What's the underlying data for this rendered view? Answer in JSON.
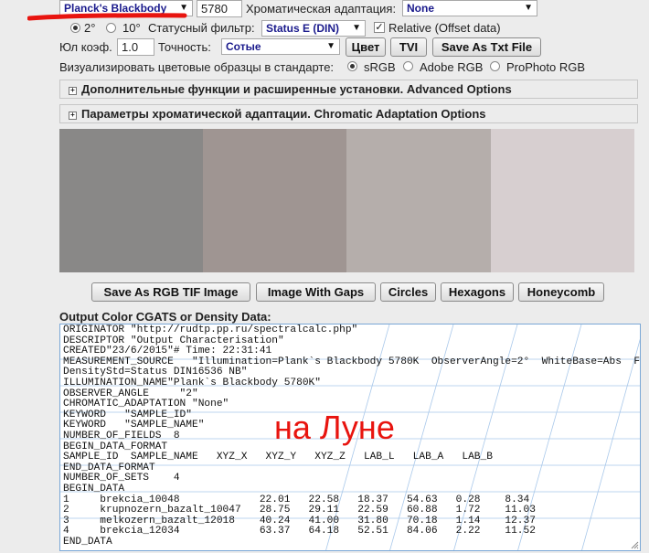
{
  "top_row": {
    "source_select": "Planck's Blackbody",
    "temperature_value": "5780",
    "adaptation_label": "Хроматическая адаптация:",
    "adaptation_select": "None"
  },
  "row2": {
    "observer_2": "2°",
    "observer_10": "10°",
    "status_filter_label": "Статусный фильтр:",
    "status_filter_select": "Status E (DIN)",
    "relative_label": "Relative (Offset data)",
    "relative_checked": "✓"
  },
  "row3": {
    "yule_label": "Юл коэф.",
    "yule_value": "1.0",
    "precision_label": "Точность:",
    "precision_select": "Сотые",
    "color_button": "Цвет",
    "tvi_button": "TVI",
    "save_txt_button": "Save As Txt File"
  },
  "row4": {
    "visualize_label": "Визуализировать цветовые образцы в стандарте:",
    "srgb": "sRGB",
    "adobe": "Adobe RGB",
    "prophoto": "ProPhoto RGB"
  },
  "panels": {
    "advanced": "Дополнительные функции и расширенные установки. Advanced Options",
    "chromatic": "Параметры хроматической адаптации. Chromatic Adaptation Options"
  },
  "swatches": [
    "#898887",
    "#9f9592",
    "#b5aeab",
    "#d7cfd0"
  ],
  "buttons": {
    "save_tif": "Save As RGB TIF Image",
    "gaps": "Image With Gaps",
    "circles": "Circles",
    "hexagons": "Hexagons",
    "honeycomb": "Honeycomb"
  },
  "output": {
    "label": "Output Color CGATS or Density Data:",
    "text": "ORIGINATOR \"http://rudtp.pp.ru/spectralcalc.php\"\nDESCRIPTOR \"Output Characterisation\"\nCREATED\"23/6/2015\"# Time: 22:31:41\nMEASUREMENT_SOURCE   \"Illumination=Plank`s Blackbody 5780K  ObserverAngle=2°  WhiteBase=Abs  Filter=No\nDensityStd=Status DIN16536 NB\"\nILLUMINATION_NAME\"Plank`s Blackbody 5780K\"\nOBSERVER_ANGLE     \"2\"\nCHROMATIC_ADAPTATION \"None\"\nKEYWORD   \"SAMPLE_ID\"\nKEYWORD   \"SAMPLE_NAME\"\nNUMBER_OF_FIELDS  8\nBEGIN_DATA_FORMAT\nSAMPLE_ID  SAMPLE_NAME   XYZ_X   XYZ_Y   XYZ_Z   LAB_L   LAB_A   LAB_B\nEND_DATA_FORMAT\nNUMBER_OF_SETS    4\nBEGIN_DATA\n1     brekcia_10048             22.01   22.58   18.37   54.63   0.28    8.34\n2     krupnozern_bazalt_10047   28.75   29.11   22.59   60.88   1.72    11.03\n3     melkozern_bazalt_12018    40.24   41.00   31.80   70.18   1.14    12.37\n4     brekcia_12034             63.37   64.18   52.51   84.06   2.22    11.52\nEND_DATA",
    "annotation": "на Луне"
  },
  "colors": {
    "accent_red": "#e8140f",
    "select_text": "#1a1a8c",
    "textarea_border": "#7aa7d6"
  }
}
